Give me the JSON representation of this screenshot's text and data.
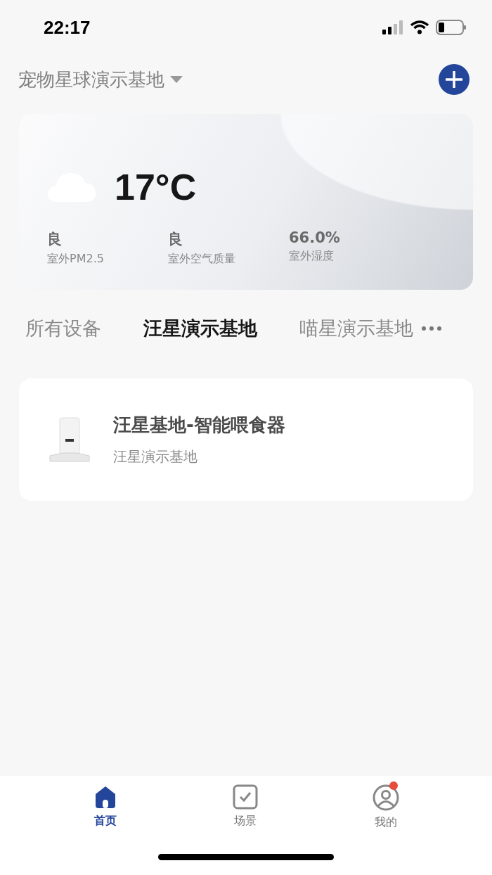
{
  "status_bar": {
    "time": "22:17"
  },
  "header": {
    "home_name": "宠物星球演示基地"
  },
  "weather": {
    "temperature": "17°C",
    "metrics": [
      {
        "value": "良",
        "label": "室外PM2.5"
      },
      {
        "value": "良",
        "label": "室外空气质量"
      },
      {
        "value": "66.0%",
        "label": "室外湿度"
      }
    ]
  },
  "room_tabs": [
    {
      "label": "所有设备",
      "selected": false
    },
    {
      "label": "汪星演示基地",
      "selected": true
    },
    {
      "label": "喵星演示基地",
      "selected": false
    }
  ],
  "devices": [
    {
      "name": "汪星基地-智能喂食器",
      "room": "汪星演示基地"
    }
  ],
  "bottom_nav": [
    {
      "kind": "home",
      "label": "首页",
      "selected": true,
      "badge": false
    },
    {
      "kind": "scene",
      "label": "场景",
      "selected": false,
      "badge": false
    },
    {
      "kind": "profile",
      "label": "我的",
      "selected": false,
      "badge": true
    }
  ]
}
